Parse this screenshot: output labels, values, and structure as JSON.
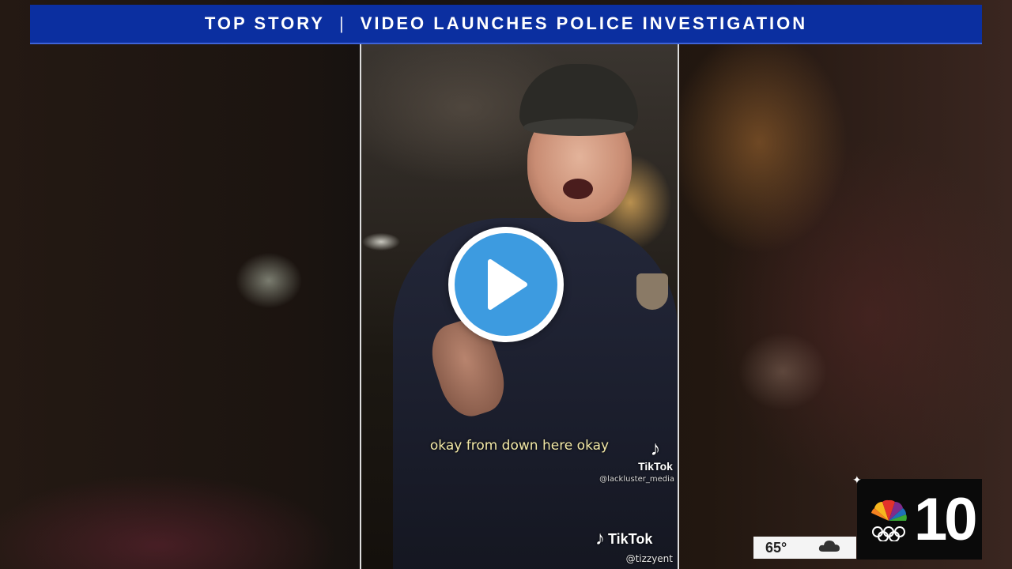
{
  "banner": {
    "left": "TOP STORY",
    "separator": "|",
    "right": "VIDEO LAUNCHES POLICE INVESTIGATION"
  },
  "video": {
    "caption": "okay from down here okay",
    "tiktok_label_1": "TikTok",
    "handle_1": "@lackluster_media",
    "tiktok_label_2": "TikTok",
    "handle_2": "@tizzyent"
  },
  "weather": {
    "temperature": "65°",
    "icon": "cloud-icon"
  },
  "station": {
    "channel": "10",
    "logo": "nbc-peacock-logo"
  },
  "colors": {
    "banner": "#0b2fa0",
    "play_accent": "#3d9be0"
  }
}
